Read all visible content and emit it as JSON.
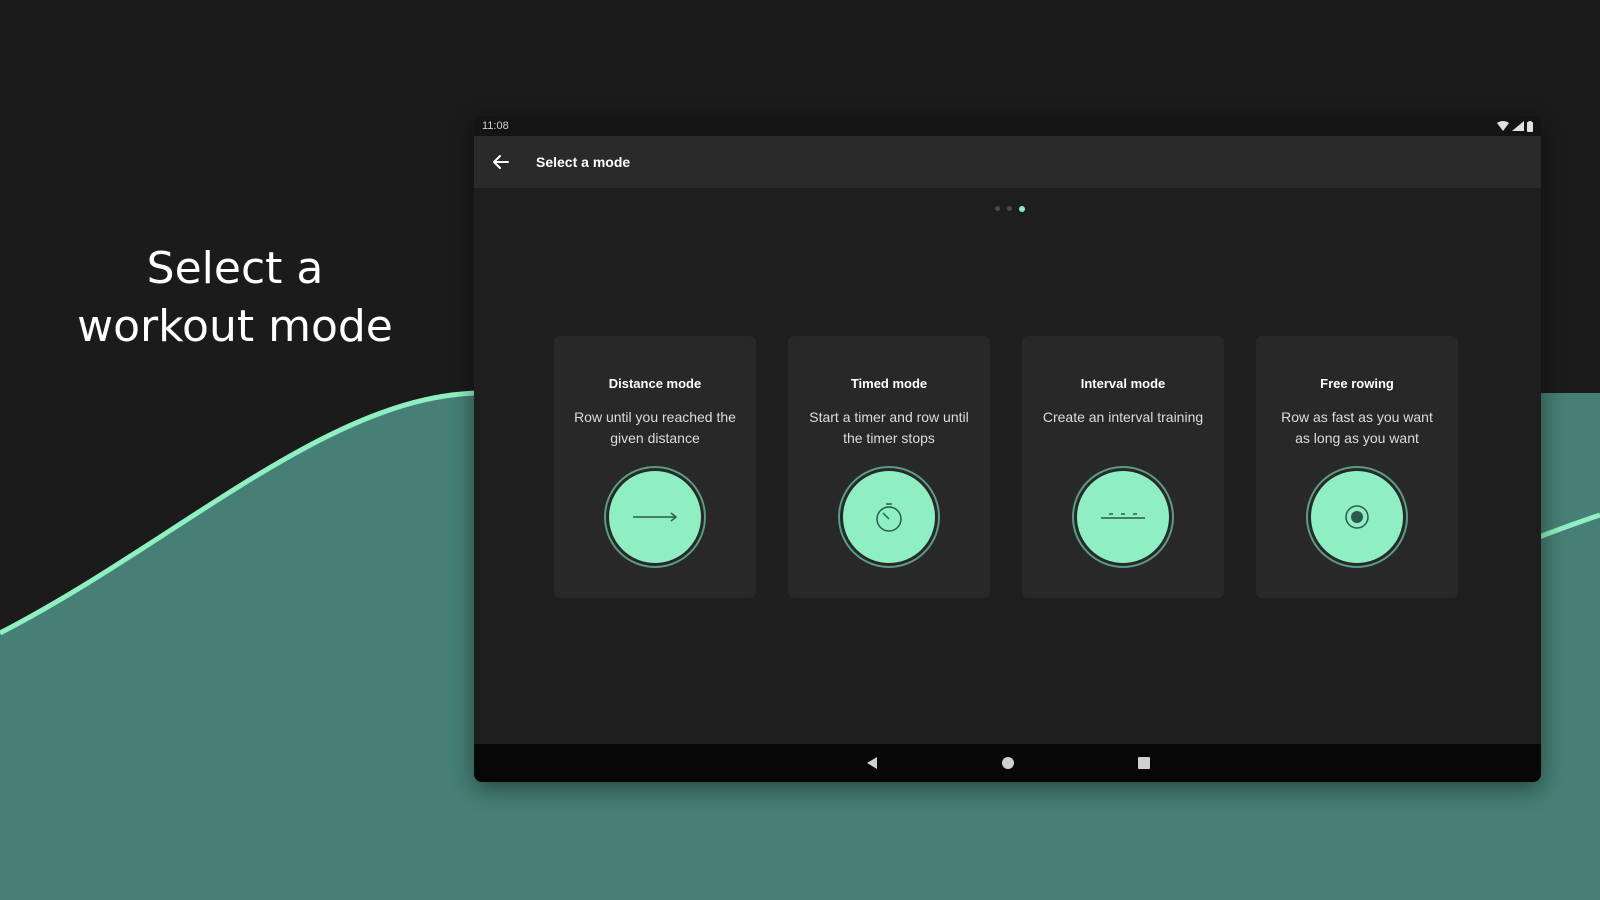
{
  "promo": {
    "line1": "Select a",
    "line2": "workout mode"
  },
  "colors": {
    "accent": "#8fefc2",
    "wave": "#467f75",
    "background": "#1b1b1b"
  },
  "status_bar": {
    "time": "11:08",
    "icons": [
      "wifi-icon",
      "signal-icon",
      "battery-icon"
    ]
  },
  "app_bar": {
    "title": "Select a mode",
    "back_icon": "arrow-left-icon"
  },
  "pager": {
    "total": 3,
    "active": 3
  },
  "modes": [
    {
      "title": "Distance mode",
      "description": "Row until you reached the given distance",
      "icon": "distance-arrow-icon"
    },
    {
      "title": "Timed mode",
      "description": "Start a timer and row until the timer stops",
      "icon": "timer-icon"
    },
    {
      "title": "Interval mode",
      "description": "Create an interval training",
      "icon": "interval-icon"
    },
    {
      "title": "Free rowing",
      "description": "Row as fast as you want as long as you want",
      "icon": "target-icon"
    }
  ],
  "nav_bar": {
    "buttons": [
      "back-triangle-icon",
      "home-circle-icon",
      "recents-square-icon"
    ]
  }
}
